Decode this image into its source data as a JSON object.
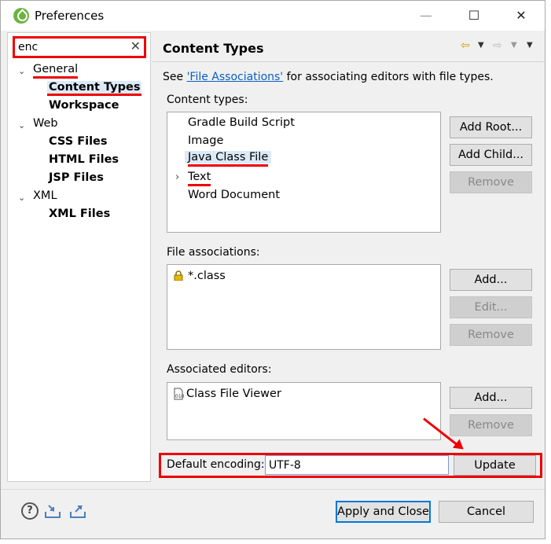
{
  "window": {
    "title": "Preferences"
  },
  "titlebar": {
    "minimize": "—",
    "maximize": "☐",
    "close": "✕"
  },
  "search": {
    "value": "enc",
    "clear_icon": "✕"
  },
  "tree": [
    {
      "label": "General",
      "expanded": true,
      "children": [
        "Content Types",
        "Workspace"
      ]
    },
    {
      "label": "Web",
      "expanded": true,
      "children": [
        "CSS Files",
        "HTML Files",
        "JSP Files"
      ]
    },
    {
      "label": "XML",
      "expanded": true,
      "children": [
        "XML Files"
      ]
    }
  ],
  "page": {
    "title": "Content Types",
    "see_prefix": "See ",
    "see_link": "'File Associations'",
    "see_suffix": " for associating editors with file types."
  },
  "content_types": {
    "label": "Content types:",
    "items": [
      "Gradle Build Script",
      "Image",
      "Java Class File",
      "Text",
      "Word Document"
    ],
    "buttons": {
      "add_root": "Add Root...",
      "add_child": "Add Child...",
      "remove": "Remove"
    }
  },
  "file_associations": {
    "label": "File associations:",
    "items": [
      "*.class"
    ],
    "buttons": {
      "add": "Add...",
      "edit": "Edit...",
      "remove": "Remove"
    }
  },
  "associated_editors": {
    "label": "Associated editors:",
    "items": [
      "Class File Viewer"
    ],
    "buttons": {
      "add": "Add...",
      "remove": "Remove"
    }
  },
  "encoding": {
    "label": "Default encoding:",
    "value": "UTF-8",
    "update": "Update"
  },
  "footer": {
    "help": "?",
    "apply_close": "Apply and Close",
    "cancel": "Cancel"
  },
  "colors": {
    "accent": "#0078d7",
    "highlight": "#e00000",
    "link": "#0b5ebf"
  }
}
